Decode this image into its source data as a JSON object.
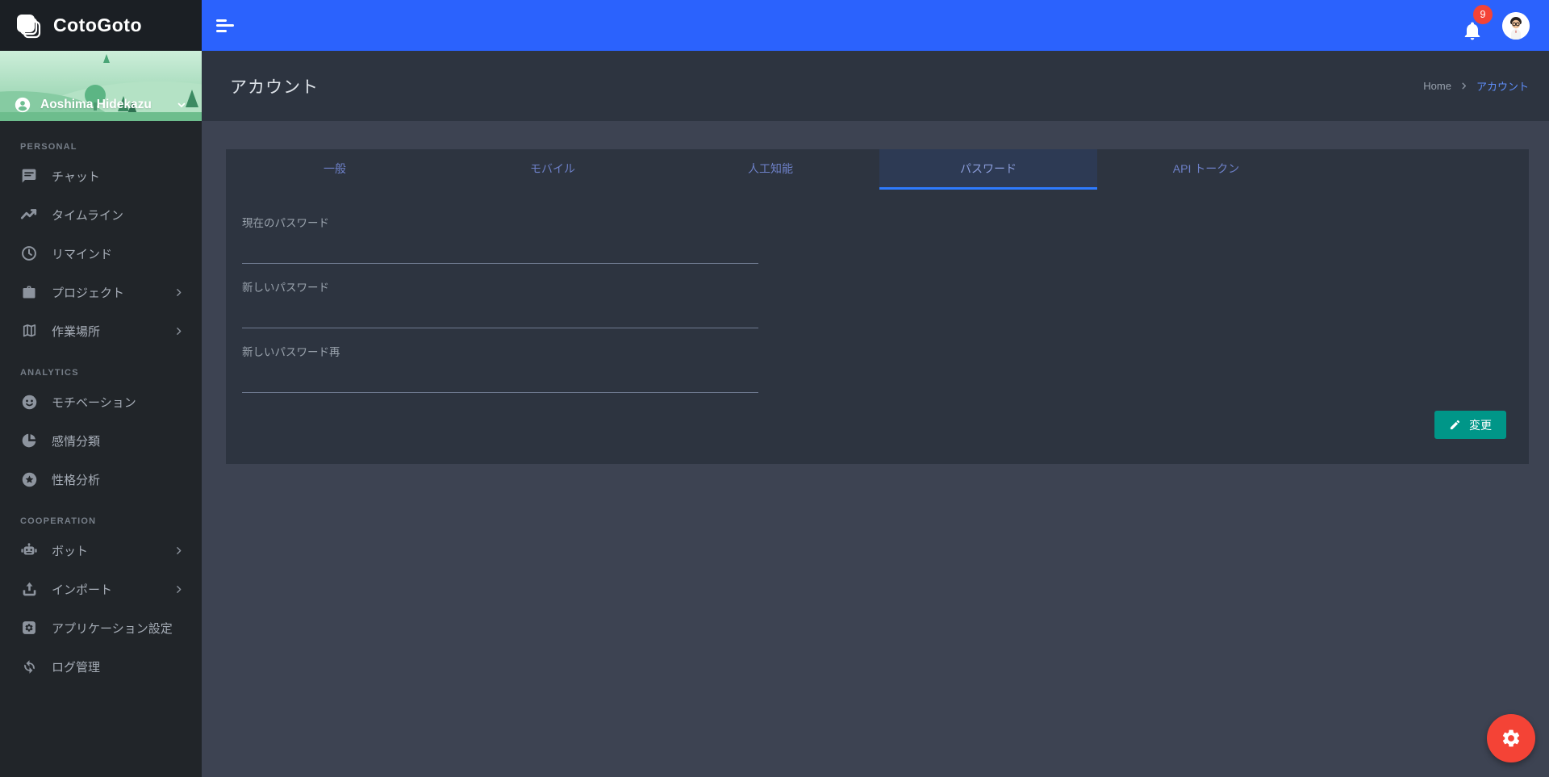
{
  "brand": {
    "name": "CotoGoto"
  },
  "topbar": {
    "notification_count": "9"
  },
  "user": {
    "name": "Aoshima Hidekazu"
  },
  "page": {
    "title": "アカウント",
    "breadcrumb": {
      "home": "Home",
      "current": "アカウント"
    }
  },
  "sidebar": {
    "sections": [
      {
        "header": "PERSONAL",
        "items": [
          {
            "label": "チャット",
            "icon": "chat-icon"
          },
          {
            "label": "タイムライン",
            "icon": "timeline-icon"
          },
          {
            "label": "リマインド",
            "icon": "remind-clock-icon"
          },
          {
            "label": "プロジェクト",
            "icon": "project-briefcase-icon",
            "expandable": true
          },
          {
            "label": "作業場所",
            "icon": "workplace-map-icon",
            "expandable": true
          }
        ]
      },
      {
        "header": "ANALYTICS",
        "items": [
          {
            "label": "モチベーション",
            "icon": "motivation-face-icon"
          },
          {
            "label": "感情分類",
            "icon": "emotion-pie-icon"
          },
          {
            "label": "性格分析",
            "icon": "personality-star-icon"
          }
        ]
      },
      {
        "header": "COOPERATION",
        "items": [
          {
            "label": "ボット",
            "icon": "bot-icon",
            "expandable": true
          },
          {
            "label": "インポート",
            "icon": "import-upload-icon",
            "expandable": true
          },
          {
            "label": "アプリケーション設定",
            "icon": "app-settings-icon"
          },
          {
            "label": "ログ管理",
            "icon": "log-sync-icon"
          }
        ]
      }
    ]
  },
  "tabs": [
    {
      "label": "一般",
      "active": false
    },
    {
      "label": "モバイル",
      "active": false
    },
    {
      "label": "人工知能",
      "active": false
    },
    {
      "label": "パスワード",
      "active": true
    },
    {
      "label": "API トークン",
      "active": false
    }
  ],
  "form": {
    "fields": [
      {
        "label": "現在のパスワード",
        "value": ""
      },
      {
        "label": "新しいパスワード",
        "value": ""
      },
      {
        "label": "新しいパスワード再",
        "value": ""
      }
    ],
    "submit_label": "変更"
  },
  "colors": {
    "topbar_blue": "#2b62fd",
    "sidebar_bg": "#212529",
    "panel_bg": "#2d3440",
    "content_bg": "#3d4352",
    "accent_link": "#5f8efa",
    "tab_underline": "#2e7bff",
    "button_teal": "#009688",
    "alert_red": "#f44336"
  }
}
